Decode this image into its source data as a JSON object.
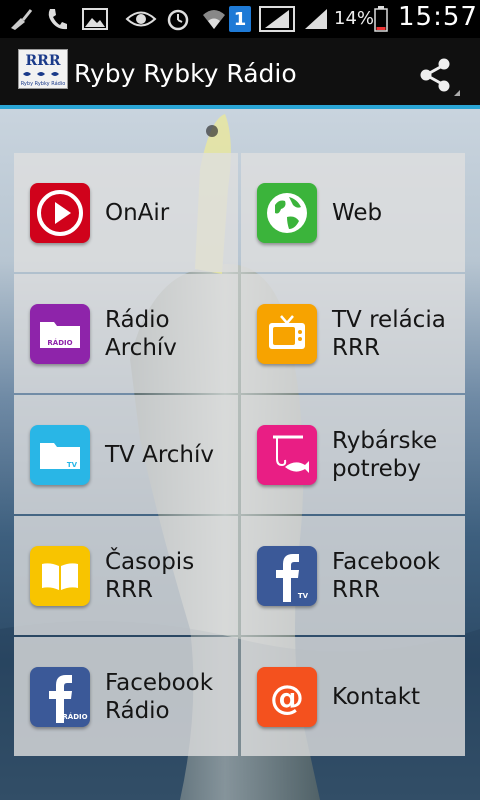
{
  "status_bar": {
    "battery_percent": "14%",
    "clock": "15:57",
    "notification_count": "1"
  },
  "app_bar": {
    "title": "Ryby Rybky Rádio",
    "logo_text": "RRR",
    "logo_subtext": "Ryby Rybky Rádio"
  },
  "tiles": [
    {
      "label": "OnAir",
      "icon": "play-icon",
      "color": "#d0021b"
    },
    {
      "label": "Web",
      "icon": "globe-icon",
      "color": "#3bb43b"
    },
    {
      "label": "Rádio\nArchív",
      "icon": "radio-folder-icon",
      "color": "#8e24aa",
      "badge": "RÁDIO"
    },
    {
      "label": "TV relácia\nRRR",
      "icon": "tv-icon",
      "color": "#f7a300"
    },
    {
      "label": "TV Archív",
      "icon": "tv-folder-icon",
      "color": "#29b6e6",
      "badge": "TV"
    },
    {
      "label": "Rybárske\npotreby",
      "icon": "fishing-icon",
      "color": "#e91e84"
    },
    {
      "label": "Časopis\nRRR",
      "icon": "book-icon",
      "color": "#f8c400"
    },
    {
      "label": "Facebook\nRRR",
      "icon": "facebook-tv-icon",
      "color": "#3b5998",
      "badge": "TV"
    },
    {
      "label": "Facebook\nRádio",
      "icon": "facebook-radio-icon",
      "color": "#3b5998",
      "badge": "RÁDIO"
    },
    {
      "label": "Kontakt",
      "icon": "at-sign-icon",
      "color": "#f4511e"
    }
  ],
  "colors": {
    "accent": "#2aa5d6",
    "appbar": "#101010"
  }
}
